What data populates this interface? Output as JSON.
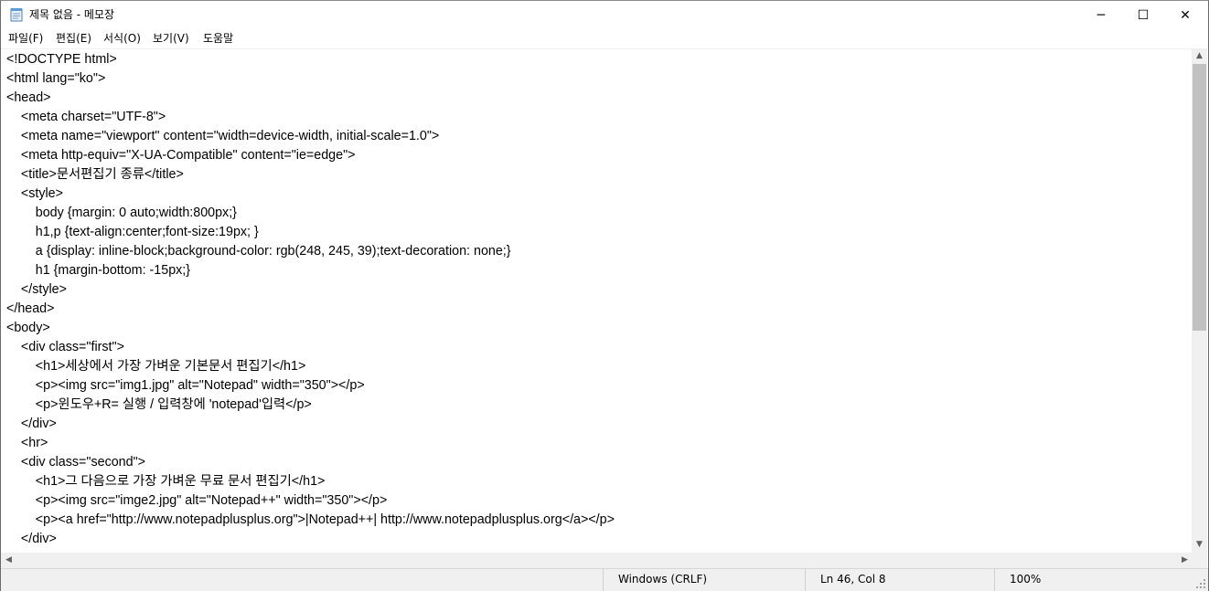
{
  "window": {
    "title": "제목 없음 - 메모장",
    "minimize_glyph": "─",
    "maximize_glyph": "☐",
    "close_glyph": "✕"
  },
  "menu": [
    {
      "label": "파일(F)"
    },
    {
      "label": "편집(E)"
    },
    {
      "label": "서식(O)"
    },
    {
      "label": "보기(V)"
    },
    {
      "label": "도움말"
    }
  ],
  "editor": {
    "lines": [
      "<!DOCTYPE html>",
      "<html lang=\"ko\">",
      "<head>",
      "    <meta charset=\"UTF-8\">",
      "    <meta name=\"viewport\" content=\"width=device-width, initial-scale=1.0\">",
      "    <meta http-equiv=\"X-UA-Compatible\" content=\"ie=edge\">",
      "    <title>문서편집기 종류</title>",
      "    <style>",
      "        body {margin: 0 auto;width:800px;}",
      "        h1,p {text-align:center;font-size:19px; }",
      "        a {display: inline-block;background-color: rgb(248, 245, 39);text-decoration: none;}",
      "        h1 {margin-bottom: -15px;}",
      "    </style>",
      "</head>",
      "<body>",
      "    <div class=\"first\">",
      "        <h1>세상에서 가장 가벼운 기본문서 편집기</h1>",
      "        <p><img src=\"img1.jpg\" alt=\"Notepad\" width=\"350\"></p>",
      "        <p>윈도우+R= 실행 / 입력창에 'notepad'입력</p>",
      "    </div>",
      "    <hr>",
      "    <div class=\"second\">",
      "        <h1>그 다음으로 가장 가벼운 무료 문서 편집기</h1>",
      "        <p><img src=\"imge2.jpg\" alt=\"Notepad++\" width=\"350\"></p>",
      "        <p><a href=\"http://www.notepadplusplus.org\">|Notepad++| http://www.notepadplusplus.org</a></p>",
      "    </div>"
    ]
  },
  "status": {
    "line_ending": "Windows (CRLF)",
    "position": "Ln 46, Col 8",
    "zoom": "100%"
  },
  "colors": {
    "chrome_bg": "#f0f0f0",
    "scroll_thumb": "#c1c1c1",
    "text": "#000000"
  },
  "icons": {
    "app": "notepad-icon",
    "scroll_up": "triangle-up-icon",
    "scroll_down": "triangle-down-icon",
    "scroll_left": "triangle-left-icon",
    "scroll_right": "triangle-right-icon",
    "grip": "resize-grip-icon"
  }
}
